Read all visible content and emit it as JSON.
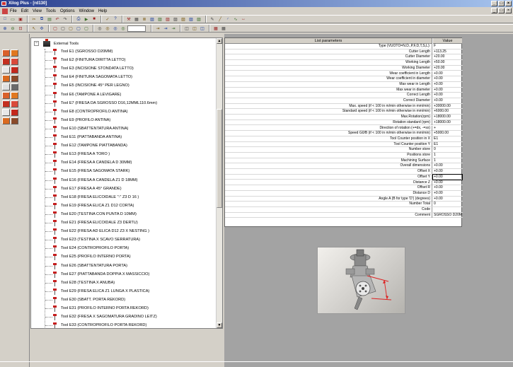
{
  "window": {
    "title": "Xilog Plus - [rd130]"
  },
  "menu": [
    "File",
    "Edit",
    "View",
    "Tools",
    "Options",
    "Window",
    "Help"
  ],
  "toolbar": {
    "row1": [
      "new-icon",
      "open-icon",
      "save-icon",
      "sep",
      "cut-icon",
      "copy-icon",
      "paste-icon",
      "undo-icon",
      "redo-icon",
      "sep",
      "print-icon",
      "run-icon",
      "stop-icon",
      "sep",
      "check-icon",
      "help-icon",
      "sep",
      "tool-icon",
      "grid-icon",
      "layer-icon",
      "view-icon",
      "view-icon",
      "view-icon",
      "view-icon",
      "view-icon",
      "view-icon",
      "view-icon",
      "sep",
      "pen-icon",
      "line-icon",
      "arc-icon",
      "curve-icon",
      "dim-icon"
    ],
    "row2": [
      "zoom-in-icon",
      "zoom-out-icon",
      "zoom-fit-icon",
      "sep",
      "arrow-icon",
      "snap-icon",
      "sep",
      "frame-icon",
      "frame-icon",
      "frame-icon",
      "frame-icon",
      "frame-icon",
      "sep",
      "lens-icon",
      "lens-icon",
      "lens-icon",
      "lens-icon",
      "combo",
      "sep",
      "nav-icon",
      "nav-icon",
      "nav-icon",
      "sep",
      "box-icon",
      "box-icon",
      "box-icon",
      "sep",
      "grid-icon",
      "grid-icon"
    ]
  },
  "tree": {
    "root": "External Tools",
    "items": [
      "Tool E1 (SGROSSO D20MM)",
      "Tool E2 (FINITURA DIRITTA LETTO)",
      "Tool E3 (INCISIONE STONDATA LETTO)",
      "Tool E4 (FINITURA SAGOMATA LETTO)",
      "Tool E5 (INCISIONE 45° PER LEGNO)",
      "Tool E6 (TAMPONE A LEVIGARE)",
      "Tool E7 (FRESA DA SGROSSO D16,12MML110.6mm)",
      "Tool E8 (CONTROPROFILO ANTINA)",
      "Tool E9 (PROFILO ANTINA)",
      "Tool E10 (SBATTENTATURA ANTINA)",
      "Tool E11 (PIATTABANDA ANTINA)",
      "Tool E12 (TAMPONE PIATTABANDA)",
      "Tool E13 (FRESA A TORO )",
      "Tool E14 (FRESA A CANDELA D 30MM)",
      "Tool E15 (FRESA SAGOMATA STARK)",
      "Tool E16 (FRESA A CANDELA Z1 D 18MM)",
      "Tool E17 (FRESA A 45° GRANDE)",
      "Tool E18 (FRESA ELICOIDALE \"-\" Z3 D 16 )",
      "Tool E19 (FRESA ELICA Z1 D12 CORTA)",
      "Tool E20 (TESTINA CON PUNTA D 10MM)",
      "Tool E21 (FRESA ELICOIDALE Z3 DERTU)",
      "Tool E22 (FRESA AD ELICA D12 Z3 X NESTING )",
      "Tool E23 (TESTINA X SCAVO SERRATURA)",
      "Tool E24 (CONTROPROFILO PORTA)",
      "Tool E25 (PROFILO INTERNO PORTA)",
      "Tool E26 (SBATTENTATURA PORTA)",
      "Tool E27 (PIATTABANDA DOPPIA X MASSICCIO)",
      "Tool E28 (TESTINA X ANUBA)",
      "Tool E29 (FRESA ELICA Z1 LUNGA X PLASTICA)",
      "Tool E30 (SBATT. PORTA REKORD)",
      "Tool E31 (PROFILO INTERNO PORTA REKORD)",
      "Tool E32 (FRESA X SAGOMATURA GRADINO LEITZ)",
      "Tool E33 (CONTROPROFILO PORTA REKORD)"
    ]
  },
  "params": {
    "header_name": "List parameters",
    "header_value": "Value",
    "selected_index": 24,
    "rows": [
      [
        "Type (VUOTO=N.D.,P,F,D,T,S,L):",
        "F"
      ],
      [
        "Cutter Length",
        "+113.25"
      ],
      [
        "Cutter Diameter",
        "+20.00"
      ],
      [
        "Working Length",
        "+50.00"
      ],
      [
        "Working Diameter",
        "+20.00"
      ],
      [
        "Wear coefficient in Length",
        "+0.00"
      ],
      [
        "Wear coefficient in diameter",
        "+0.00"
      ],
      [
        "Max wear in Length",
        "+0.00"
      ],
      [
        "Max wear in diameter",
        "+0.00"
      ],
      [
        "Correct Length",
        "+0.00"
      ],
      [
        "Correct Diameter",
        "+0.00"
      ],
      [
        "Max. speed (if < 100 in m/min otherwise in mm/min)",
        "+30000.00"
      ],
      [
        "Standard speed (if < 100 in m/min otherwise in mm/min)",
        "+6000.00"
      ],
      [
        "Max.Rotation(rpm)",
        "+18000.00"
      ],
      [
        "Rotation standard (rpm)",
        "+18000.00"
      ],
      [
        "Direction of rotation (+=dx, -=sx)",
        "+"
      ],
      [
        "Speed G0/B (if < 100 in m/min otherwise in mm/min)",
        "+5000.00"
      ],
      [
        "Tool Counter position in X",
        "E1"
      ],
      [
        "Tool Counter position Y",
        "E1"
      ],
      [
        "Number store",
        "0"
      ],
      [
        "Positions store",
        "1"
      ],
      [
        "Machining Surface",
        "1"
      ],
      [
        "Overall dimensions",
        "+0.00"
      ],
      [
        "Offset X",
        "+0.00"
      ],
      [
        "Offset Y",
        "+0.00"
      ],
      [
        "Distance Z",
        "+0.00"
      ],
      [
        "Offset R",
        "+0.00"
      ],
      [
        "Distance D",
        "+0.00"
      ],
      [
        "Angle A (B for type 'D') (degrees)",
        "+0.00"
      ],
      [
        "Number Total",
        "0"
      ],
      [
        "Code",
        ""
      ],
      [
        "Comment",
        "SGROSSO D20M"
      ]
    ]
  }
}
